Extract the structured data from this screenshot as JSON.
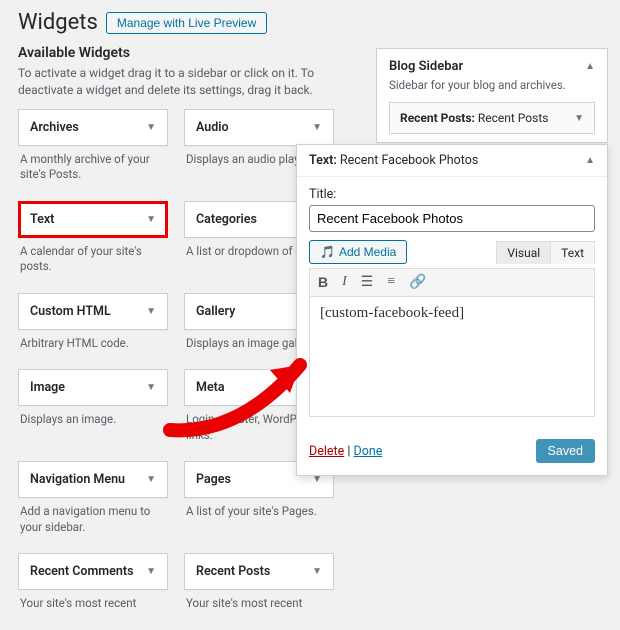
{
  "page": {
    "title": "Widgets"
  },
  "buttons": {
    "live_preview": "Manage with Live Preview"
  },
  "available": {
    "title": "Available Widgets",
    "desc": "To activate a widget drag it to a sidebar or click on it. To deactivate a widget and delete its settings, drag it back."
  },
  "widgets": {
    "archives": {
      "name": "Archives",
      "desc": "A monthly archive of your site's Posts."
    },
    "audio": {
      "name": "Audio",
      "desc": "Displays an audio player."
    },
    "text": {
      "name": "Text",
      "desc": "A calendar of your site's posts."
    },
    "categories": {
      "name": "Categories",
      "desc": "A list or dropdown of cate"
    },
    "custom_html": {
      "name": "Custom HTML",
      "desc": "Arbitrary HTML code."
    },
    "gallery": {
      "name": "Gallery",
      "desc": "Displays an image gallery."
    },
    "image": {
      "name": "Image",
      "desc": "Displays an image."
    },
    "meta": {
      "name": "Meta",
      "desc": "Login, register, WordPress links."
    },
    "nav": {
      "name": "Navigation Menu",
      "desc": "Add a navigation menu to your sidebar."
    },
    "pages": {
      "name": "Pages",
      "desc": "A list of your site's Pages."
    },
    "recent_comments": {
      "name": "Recent Comments",
      "desc": "Your site's most recent"
    },
    "recent_posts": {
      "name": "Recent Posts",
      "desc": "Your site's most recent"
    }
  },
  "sidebar": {
    "title": "Blog Sidebar",
    "desc": "Sidebar for your blog and archives.",
    "item_label": "Recent Posts:",
    "item_value": " Recent Posts"
  },
  "editor": {
    "head_label": "Text:",
    "head_value": " Recent Facebook Photos",
    "title_label": "Title:",
    "title_value": "Recent Facebook Photos",
    "add_media": "Add Media",
    "tab_visual": "Visual",
    "tab_text": "Text",
    "content": "[custom-facebook-feed]",
    "delete": "Delete",
    "done": "Done",
    "saved": "Saved"
  }
}
